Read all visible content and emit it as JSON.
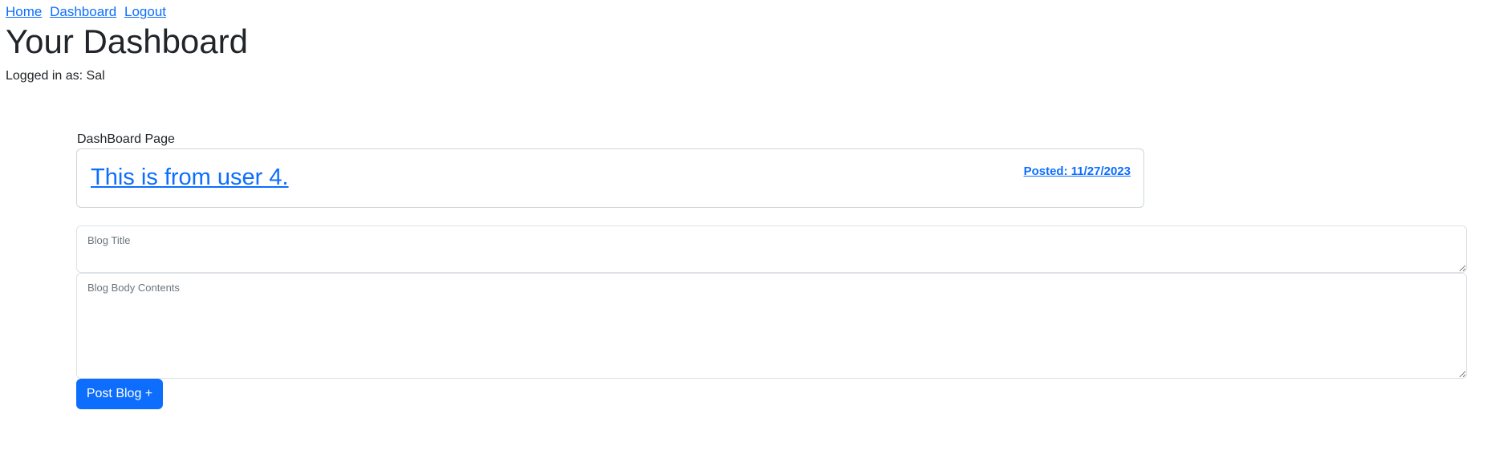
{
  "nav": {
    "links": [
      "Home",
      "Dashboard",
      "Logout"
    ]
  },
  "header": {
    "title": "Your Dashboard",
    "logged_in": "Logged in as: Sal"
  },
  "dashboard": {
    "section_label": "DashBoard Page",
    "posts": [
      {
        "title": "This is from user 4.",
        "posted": "Posted: 11/27/2023"
      }
    ]
  },
  "form": {
    "title_placeholder": "Blog Title",
    "title_value": "",
    "body_placeholder": "Blog Body Contents",
    "body_value": "",
    "submit_label": "Post Blog +"
  },
  "colors": {
    "link": "#0d6efd",
    "button": "#0d6efd",
    "border": "#ced4da",
    "text": "#212529"
  }
}
